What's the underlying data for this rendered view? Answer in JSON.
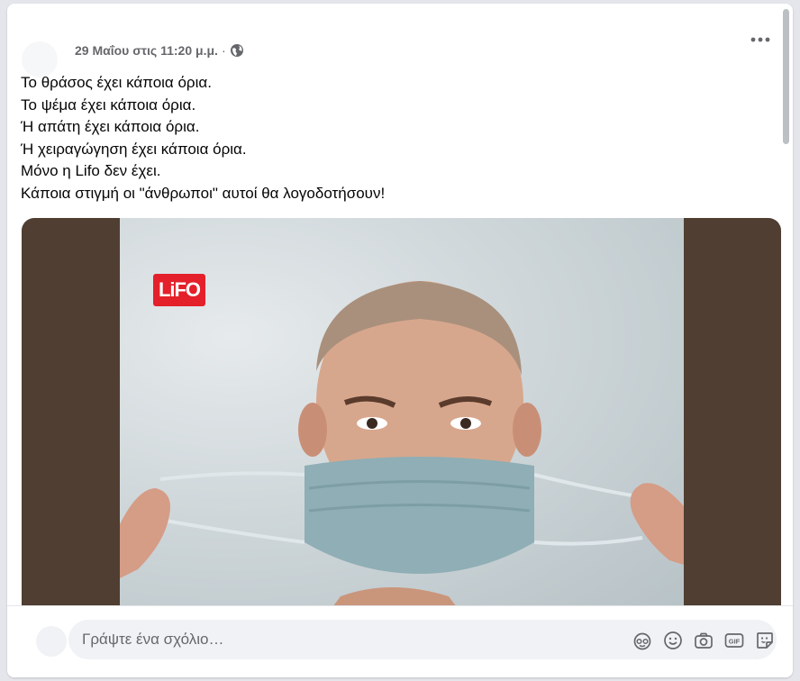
{
  "post": {
    "timestamp": "29 Μαΐου στις 11:20 μ.μ.",
    "separator": "·",
    "privacy_icon": "globe-icon",
    "more_icon": "more-horizontal-icon",
    "text_lines": [
      "Το θράσος έχει κάποια όρια.",
      "Το ψέμα έχει κάποια όρια.",
      "Ή απάτη έχει κάποια όρια.",
      "Ή χειραγώγηση έχει κάποια όρια.",
      "Μόνο η Lifo δεν έχει.",
      "Κάποια στιγμή οι \"άνθρωποι\" αυτοί θα λογοδοτήσουν!"
    ],
    "image": {
      "logo_text": "LiFO",
      "logo_color": "#e4202a",
      "frame_color": "#4f3e31"
    }
  },
  "comment": {
    "placeholder": "Γράψτε ένα σχόλιο…",
    "icons": [
      "avatar-sticker-icon",
      "emoji-icon",
      "camera-icon",
      "gif-icon",
      "sticker-icon"
    ]
  },
  "colors": {
    "text": "#050505",
    "secondary": "#65676b",
    "input_bg": "#f0f2f5"
  }
}
